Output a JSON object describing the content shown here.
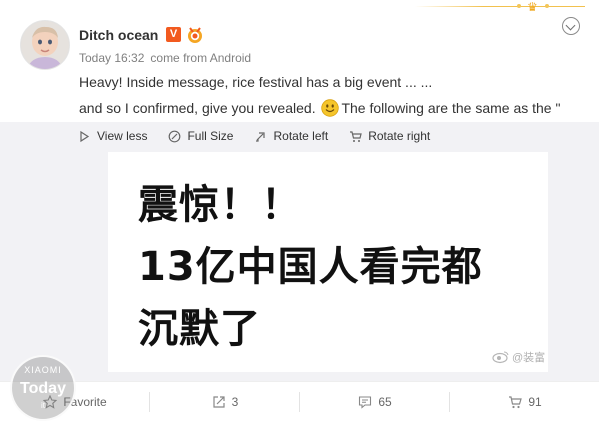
{
  "user": {
    "name": "Ditch ocean",
    "verified_badge": "V",
    "timestamp": "Today 16:32",
    "source": "come from Android"
  },
  "post": {
    "line1": "Heavy! Inside message, rice festival has a big event ... ...",
    "line2_before": "and so I confirmed, give you revealed.",
    "line2_after": "The following are the same as the \""
  },
  "media_toolbar": {
    "view_less": "View less",
    "full_size": "Full Size",
    "rotate_left": "Rotate left",
    "rotate_right": "Rotate right"
  },
  "image": {
    "line1": "震惊！！",
    "line2": "13亿中国人看完都",
    "line3": "沉默了",
    "watermark": "@装富"
  },
  "footer": {
    "favorite": "Favorite",
    "repost_count": "3",
    "comment_count": "65",
    "like_count": "91"
  },
  "logo_watermark": {
    "top": "XIAOMI",
    "brand": "Today",
    "sub": "it"
  },
  "colors": {
    "accent_orange": "#f25a1f",
    "gold": "#f2c14e",
    "media_bg": "#f2f2f5",
    "smiley": "#f5c52b"
  }
}
